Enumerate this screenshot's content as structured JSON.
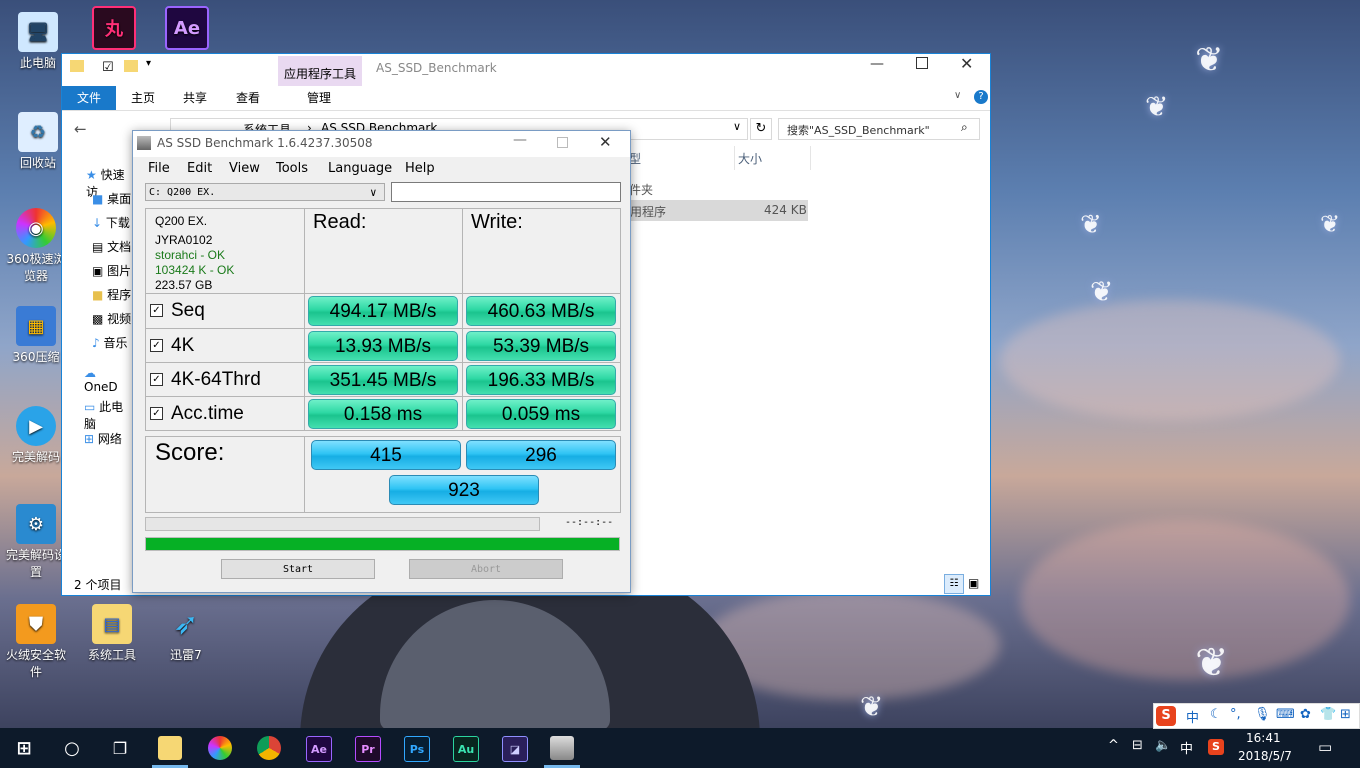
{
  "desktop": {
    "icons": [
      {
        "label": "此电脑",
        "glyph": "🖥"
      },
      {
        "label": "回收站",
        "glyph": "♻"
      },
      {
        "label": "360极速浏览器",
        "glyph": "◉"
      },
      {
        "label": "360压缩",
        "glyph": "▦"
      },
      {
        "label": "完美解码",
        "glyph": "▶"
      },
      {
        "label": "完美解码设置",
        "glyph": "⚙"
      },
      {
        "label": "火绒安全软件",
        "glyph": "⛊"
      },
      {
        "label": "系统工具",
        "glyph": "▤"
      },
      {
        "label": "迅雷7",
        "glyph": "➶"
      },
      {
        "label": "丸",
        "glyph": "丸"
      },
      {
        "label": "Ae",
        "glyph": "Ae"
      }
    ]
  },
  "explorer": {
    "title": "AS_SSD_Benchmark",
    "context_tab": "应用程序工具",
    "tabs": [
      "文件",
      "主页",
      "共享",
      "查看",
      "管理"
    ],
    "path": [
      "系统工具",
      "AS SSD Benchmark"
    ],
    "search_placeholder": "搜索\"AS_SSD_Benchmark\"",
    "columns": [
      "型",
      "大小"
    ],
    "files": [
      {
        "type": "件夹",
        "size": ""
      },
      {
        "type": "用程序",
        "size": "424 KB"
      }
    ],
    "nav": [
      "快速访",
      "桌面",
      "下载",
      "文档",
      "图片",
      "程序",
      "视频",
      "音乐",
      "OneD",
      "此电脑",
      "网络"
    ],
    "status": "2 个项目"
  },
  "asssd": {
    "title": "AS SSD Benchmark 1.6.4237.30508",
    "menu": [
      "File",
      "Edit",
      "View",
      "Tools",
      "Language",
      "Help"
    ],
    "drive_select": "C: Q200 EX.",
    "info": {
      "model": "Q200 EX.",
      "firmware": "JYRA0102",
      "driver": "storahci - OK",
      "align": "103424 K - OK",
      "size": "223.57 GB"
    },
    "headers": {
      "read": "Read:",
      "write": "Write:"
    },
    "rows": [
      {
        "label": "Seq",
        "read": "494.17 MB/s",
        "write": "460.63 MB/s"
      },
      {
        "label": "4K",
        "read": "13.93 MB/s",
        "write": "53.39 MB/s"
      },
      {
        "label": "4K-64Thrd",
        "read": "351.45 MB/s",
        "write": "196.33 MB/s"
      },
      {
        "label": "Acc.time",
        "read": "0.158 ms",
        "write": "0.059 ms"
      }
    ],
    "score_label": "Score:",
    "score_read": "415",
    "score_write": "296",
    "score_total": "923",
    "time": "--:--:--",
    "progress": 1.0,
    "start_label": "Start",
    "abort_label": "Abort"
  },
  "taskbar": {
    "apps": [
      "Ae",
      "Pr",
      "Ps",
      "Au"
    ],
    "ime": "中",
    "time": "16:41",
    "date": "2018/5/7"
  }
}
